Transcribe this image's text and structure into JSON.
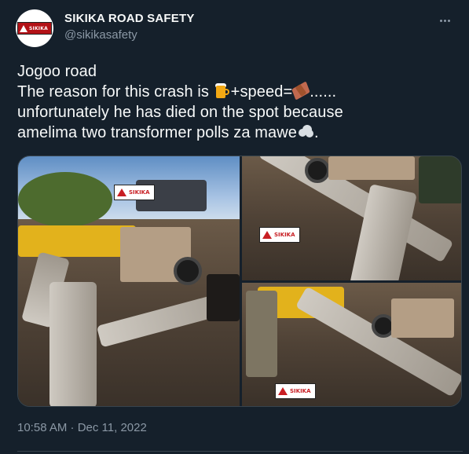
{
  "account": {
    "display_name": "SIKIKA ROAD SAFETY",
    "handle": "@sikikasafety",
    "avatar_logo_text": "SIKIKA"
  },
  "tweet": {
    "line1": "Jogoo road",
    "line2_a": "The reason for this crash is ",
    "line2_b": "+speed=",
    "line2_c": "......",
    "line3": "unfortunately he has died on the spot because",
    "line4_a": "amelima two transformer polls za mawe",
    "line4_b": ".",
    "emojis": [
      "beer-mugs-icon",
      "coffin-icon",
      "rock-icon"
    ]
  },
  "media": {
    "watermark_text": "SIKIKA",
    "photos": [
      "photo-left",
      "photo-top-right",
      "photo-bottom-right"
    ]
  },
  "timestamp": "10:58 AM · Dec 11, 2022",
  "colors": {
    "background": "#15202b",
    "text": "#f7f9f9",
    "secondary": "#8b98a5",
    "border": "#38444d"
  }
}
